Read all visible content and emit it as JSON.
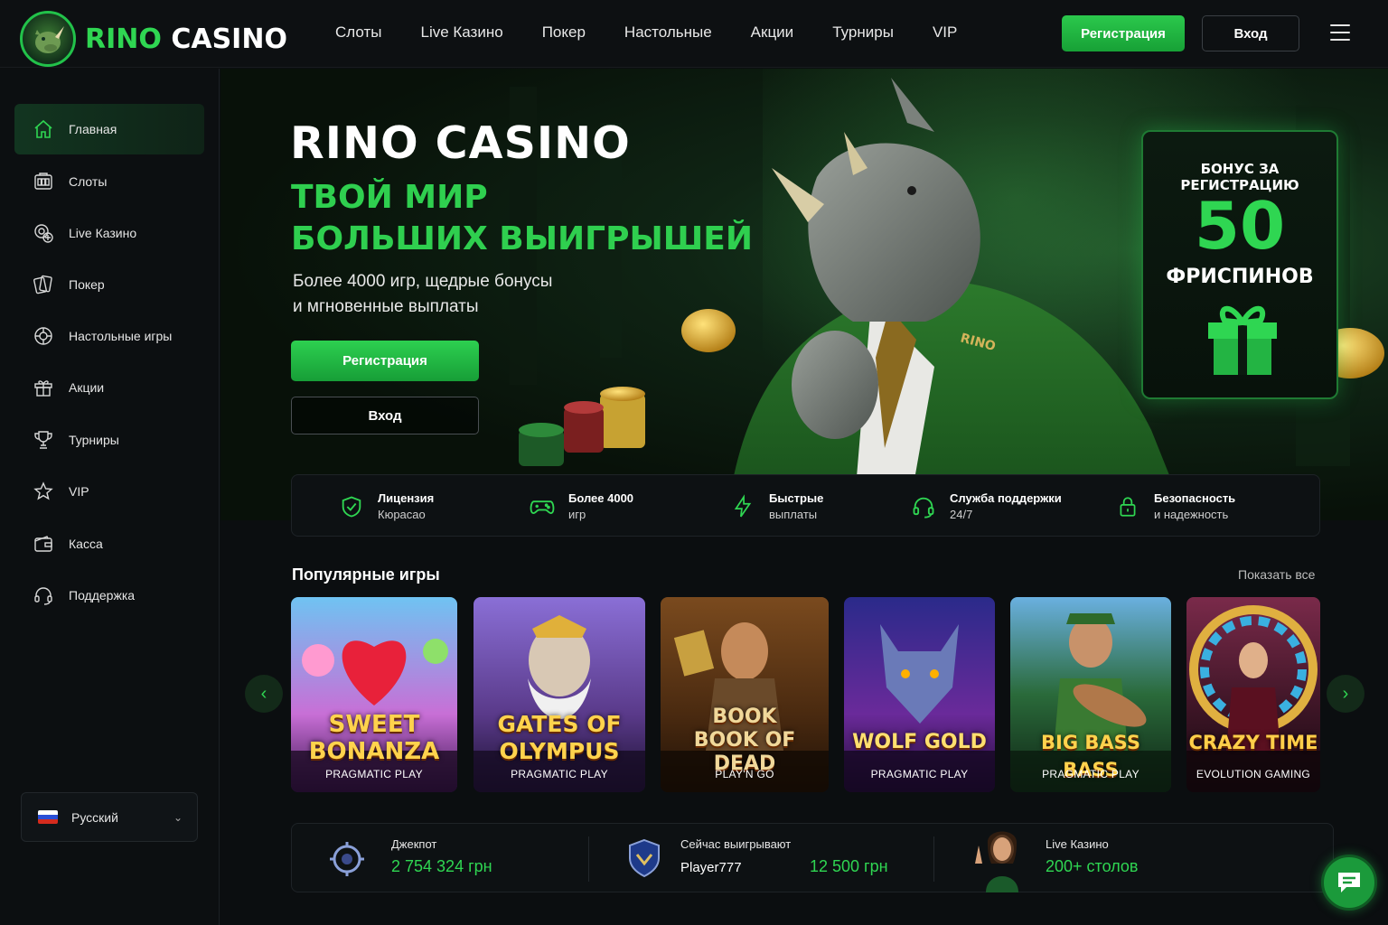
{
  "brand": {
    "name_green": "RINO",
    "name_white": "CASINO"
  },
  "topnav": [
    "Слоты",
    "Live Казино",
    "Покер",
    "Настольные",
    "Акции",
    "Турниры",
    "VIP"
  ],
  "header": {
    "register": "Регистрация",
    "login": "Вход"
  },
  "sidebar": {
    "items": [
      {
        "label": "Главная",
        "icon": "home-icon",
        "active": true
      },
      {
        "label": "Слоты",
        "icon": "slots-icon"
      },
      {
        "label": "Live Казино",
        "icon": "live-casino-icon"
      },
      {
        "label": "Покер",
        "icon": "poker-icon"
      },
      {
        "label": "Настольные игры",
        "icon": "table-games-icon"
      },
      {
        "label": "Акции",
        "icon": "gift-icon"
      },
      {
        "label": "Турниры",
        "icon": "trophy-icon"
      },
      {
        "label": "VIP",
        "icon": "star-icon"
      },
      {
        "label": "Касса",
        "icon": "wallet-icon"
      },
      {
        "label": "Поддержка",
        "icon": "headset-icon"
      }
    ],
    "language": "Русский"
  },
  "hero": {
    "title": "RINO CASINO",
    "subtitle_line1": "ТВОЙ МИР",
    "subtitle_line2": "БОЛЬШИХ ВЫИГРЫШЕЙ",
    "desc_line1": "Более 4000 игр, щедрые бонусы",
    "desc_line2": "и мгновенные выплаты",
    "register": "Регистрация",
    "login": "Вход",
    "jacket_label": "RINO"
  },
  "bonus": {
    "title": "БОНУС ЗА РЕГИСТРАЦИЮ",
    "amount": "50",
    "unit": "ФРИСПИНОВ"
  },
  "features": [
    {
      "title": "Лицензия",
      "sub": "Кюрасао",
      "icon": "shield-check-icon"
    },
    {
      "title": "Более 4000",
      "sub": "игр",
      "icon": "gamepad-icon"
    },
    {
      "title": "Быстрые",
      "sub": "выплаты",
      "icon": "lightning-icon"
    },
    {
      "title": "Служба поддержки",
      "sub": "24/7",
      "icon": "headset-icon"
    },
    {
      "title": "Безопасность",
      "sub": "и надежность",
      "icon": "lock-icon"
    }
  ],
  "popular": {
    "title": "Популярные игры",
    "show_all": "Показать все",
    "games": [
      {
        "title": "SWEET BONANZA",
        "provider": "PRAGMATIC PLAY"
      },
      {
        "title": "GATES OF OLYMPUS",
        "provider": "PRAGMATIC PLAY"
      },
      {
        "title_top": "BOOK",
        "title": "BOOK OF DEAD",
        "provider": "PLAY'N GO"
      },
      {
        "title": "WOLF GOLD",
        "provider": "PRAGMATIC PLAY"
      },
      {
        "title": "BIG BASS BASS",
        "provider": "PRAGMATIC PLAY"
      },
      {
        "title": "CRAZY TIME",
        "provider": "EVOLUTION GAMING"
      }
    ]
  },
  "stats": {
    "jackpot_label": "Джекпот",
    "jackpot_value": "2 754 324 грн",
    "winning_label": "Сейчас выигрывают",
    "winning_player": "Player777",
    "winning_value": "12 500 грн",
    "live_label": "Live Казино",
    "live_value": "200+ столов"
  },
  "colors": {
    "accent": "#2fd652",
    "background": "#0b0e10"
  }
}
